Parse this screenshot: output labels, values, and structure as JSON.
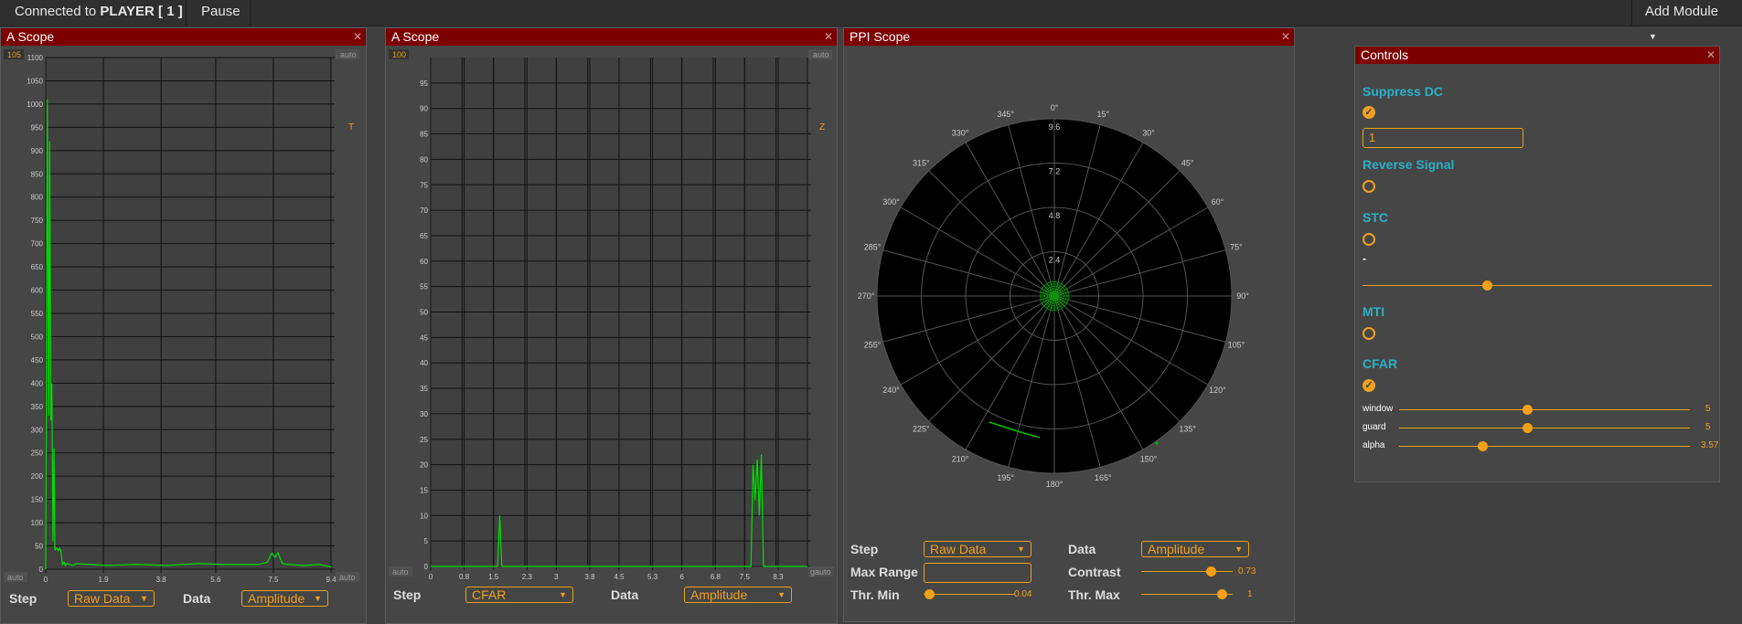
{
  "topbar": {
    "connected_prefix": "Connected to ",
    "player_name": "PLAYER [ 1 ]",
    "pause_label": "Pause",
    "add_module_label": "Add Module"
  },
  "scope1": {
    "title": "A Scope",
    "close_icon": "✕",
    "top_badge": "105",
    "auto_top": "auto",
    "auto_bottom_left": "auto",
    "auto_bottom_right": "auto",
    "marker": "T",
    "step_label": "Step",
    "step_value": "Raw Data",
    "data_label": "Data",
    "data_value": "Amplitude"
  },
  "scope2": {
    "title": "A Scope",
    "close_icon": "✕",
    "top_badge": "100",
    "auto_top": "auto",
    "auto_bottom_left": "auto",
    "auto_bottom_right": "gauto",
    "marker": "Z",
    "step_label": "Step",
    "step_value": "CFAR",
    "data_label": "Data",
    "data_value": "Amplitude"
  },
  "ppi": {
    "title": "PPI Scope",
    "close_icon": "✕",
    "step_label": "Step",
    "step_value": "Raw Data",
    "data_label": "Data",
    "data_value": "Amplitude",
    "max_range_label": "Max Range",
    "max_range_value": "",
    "contrast_label": "Contrast",
    "contrast_value": "0.73",
    "thr_min_label": "Thr. Min",
    "thr_min_value": "0.04",
    "thr_max_label": "Thr. Max",
    "thr_max_value": "1",
    "angle_labels": [
      "0°",
      "15°",
      "30°",
      "45°",
      "60°",
      "75°",
      "90°",
      "105°",
      "120°",
      "135°",
      "150°",
      "165°",
      "180°",
      "195°",
      "210°",
      "225°",
      "240°",
      "255°",
      "270°",
      "285°",
      "300°",
      "315°",
      "330°",
      "345°"
    ],
    "range_labels": [
      "2.4",
      "4.8",
      "7.2",
      "9.6"
    ]
  },
  "controls": {
    "title": "Controls",
    "close_icon": "✕",
    "suppress_dc_label": "Suppress DC",
    "suppress_dc_checked": true,
    "suppress_dc_value": "1",
    "reverse_signal_label": "Reverse Signal",
    "stc_label": "STC",
    "stc_dash": "-",
    "mti_label": "MTI",
    "cfar_label": "CFAR",
    "window_label": "window",
    "window_value": "5",
    "guard_label": "guard",
    "guard_value": "5",
    "alpha_label": "alpha",
    "alpha_value": "3.57"
  },
  "chart_data": [
    {
      "type": "line",
      "title": "A Scope",
      "xlabel": "",
      "ylabel": "",
      "x_ticks": [
        "0",
        "1.9",
        "3.8",
        "5.6",
        "7.5",
        "9.4"
      ],
      "y_ticks": [
        "0",
        "50",
        "100",
        "150",
        "200",
        "250",
        "300",
        "350",
        "400",
        "450",
        "500",
        "550",
        "600",
        "650",
        "700",
        "750",
        "800",
        "850",
        "900",
        "950",
        "1000",
        "1050",
        "1100"
      ],
      "xlim": [
        0,
        9.4
      ],
      "ylim": [
        0,
        1100
      ],
      "grid": true,
      "series": [
        {
          "x": [
            0,
            0.05,
            0.1,
            0.13,
            0.17,
            0.2,
            0.24,
            0.27,
            0.3,
            0.34,
            0.38,
            0.42,
            0.46,
            0.5,
            0.55,
            0.6,
            0.65,
            0.7,
            0.8,
            0.9,
            1.0,
            2.0,
            3.0,
            4.0,
            5.0,
            6.0,
            7.0,
            7.3,
            7.45,
            7.55,
            7.65,
            7.8,
            8.0,
            8.5,
            9.0,
            9.4
          ],
          "y": [
            0,
            1010,
            330,
            920,
            320,
            400,
            60,
            260,
            40,
            45,
            45,
            40,
            45,
            40,
            10,
            15,
            8,
            12,
            10,
            8,
            12,
            8,
            10,
            8,
            12,
            10,
            10,
            15,
            35,
            25,
            35,
            12,
            10,
            8,
            10,
            5
          ]
        }
      ]
    },
    {
      "type": "line",
      "title": "A Scope",
      "xlabel": "",
      "ylabel": "",
      "x_ticks": [
        "0",
        "0.8",
        "1.5",
        "2.3",
        "3",
        "3.8",
        "4.5",
        "5.3",
        "6",
        "6.8",
        "7.5",
        "8.3"
      ],
      "y_ticks": [
        "0",
        "5",
        "10",
        "15",
        "20",
        "25",
        "30",
        "35",
        "40",
        "45",
        "50",
        "55",
        "60",
        "65",
        "70",
        "75",
        "80",
        "85",
        "90",
        "95"
      ],
      "xlim": [
        0,
        9.0
      ],
      "ylim": [
        0,
        100
      ],
      "grid": true,
      "series": [
        {
          "x": [
            0,
            1.55,
            1.6,
            1.65,
            1.7,
            1.75,
            7.6,
            7.65,
            7.7,
            7.75,
            7.8,
            7.85,
            7.9,
            7.95,
            8.0,
            9.0
          ],
          "y": [
            0,
            0,
            0,
            10,
            0,
            0,
            0,
            0,
            20,
            13,
            21,
            10,
            22,
            0,
            0,
            0
          ]
        }
      ]
    }
  ]
}
